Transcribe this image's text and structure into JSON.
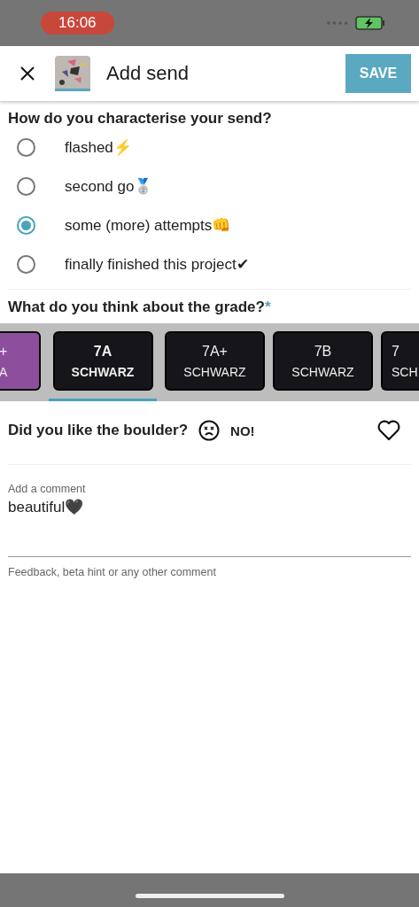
{
  "status_bar": {
    "time": "16:06"
  },
  "app_bar": {
    "title": "Add send",
    "action": "SAVE"
  },
  "send_type": {
    "question": "How do you characterise your send?",
    "options": [
      {
        "label": "flashed⚡",
        "selected": false
      },
      {
        "label": "second go🥈",
        "selected": false
      },
      {
        "label": "some (more) attempts👊",
        "selected": true
      },
      {
        "label": "finally finished this project✔",
        "selected": false
      }
    ]
  },
  "grade": {
    "question": "What do you think about the grade?",
    "required_mark": "*",
    "cards": [
      {
        "kind": "cut-left",
        "grade": "+",
        "color_name": "A",
        "color": "#8e4e9e",
        "selected": false
      },
      {
        "kind": "full",
        "grade": "7A",
        "color_name": "SCHWARZ",
        "color": "#16161a",
        "selected": true
      },
      {
        "kind": "full",
        "grade": "7A+",
        "color_name": "SCHWARZ",
        "color": "#16161a",
        "selected": false
      },
      {
        "kind": "full",
        "grade": "7B",
        "color_name": "SCHWARZ",
        "color": "#16161a",
        "selected": false
      },
      {
        "kind": "cut-right",
        "grade": "7",
        "color_name": "SCH",
        "color": "#16161a",
        "selected": false
      }
    ]
  },
  "like": {
    "question": "Did you like the boulder?",
    "answer": "NO!",
    "liked": false
  },
  "comment": {
    "label": "Add a comment",
    "value": "beautiful🖤",
    "helper": "Feedback, beta hint or any other comment"
  }
}
